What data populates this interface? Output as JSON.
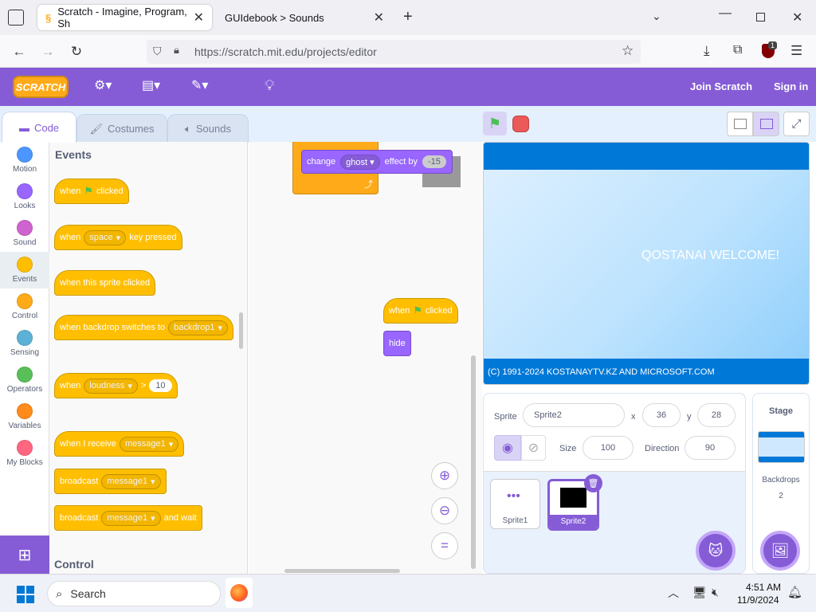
{
  "browser": {
    "tabs": [
      {
        "label": "Scratch - Imagine, Program, Sh"
      },
      {
        "label": "GUIdebook > Sounds"
      }
    ],
    "url": "https://scratch.mit.edu/projects/editor",
    "ext_badge": "1"
  },
  "menu": {
    "logo": "SCRATCH",
    "join": "Join Scratch",
    "signin": "Sign in"
  },
  "editor_tabs": [
    "Code",
    "Costumes",
    "Sounds"
  ],
  "categories": [
    {
      "label": "Motion",
      "color": "#4c97ff"
    },
    {
      "label": "Looks",
      "color": "#9966ff"
    },
    {
      "label": "Sound",
      "color": "#cf63cf"
    },
    {
      "label": "Events",
      "color": "#ffbf00"
    },
    {
      "label": "Control",
      "color": "#ffab19"
    },
    {
      "label": "Sensing",
      "color": "#5cb1d6"
    },
    {
      "label": "Operators",
      "color": "#59c059"
    },
    {
      "label": "Variables",
      "color": "#ff8c1a"
    },
    {
      "label": "My Blocks",
      "color": "#ff6680"
    }
  ],
  "palette": {
    "title": "Events",
    "control_title": "Control",
    "blocks": {
      "flag_when": "when",
      "flag_clicked": "clicked",
      "key_when": "when",
      "key_value": "space",
      "key_pressed": "key pressed",
      "sprite_clicked": "when this sprite clicked",
      "backdrop_text": "when backdrop switches to",
      "backdrop_value": "backdrop1",
      "loud_when": "when",
      "loud_value": "loudness",
      "loud_op": ">",
      "loud_num": "10",
      "receive_text": "when I receive",
      "receive_value": "message1",
      "broadcast_text": "broadcast",
      "broadcast_value": "message1",
      "bwait_text": "broadcast",
      "bwait_value": "message1",
      "bwait_end": "and wait"
    }
  },
  "scripts": {
    "change_text": "change",
    "change_value": "ghost",
    "effect_text": "effect by",
    "effect_num": "-15",
    "hat_when": "when",
    "hat_clicked": "clicked",
    "hide_text": "hide"
  },
  "stage": {
    "welcome": "QOSTANAI WELCOME!",
    "footer": "(C) 1991-2024 KOSTANAYTV.KZ AND MICROSOFT.COM"
  },
  "sprite_info": {
    "sprite_label": "Sprite",
    "sprite_name": "Sprite2",
    "x_label": "x",
    "x": "36",
    "y_label": "y",
    "y": "28",
    "size_label": "Size",
    "size": "100",
    "dir_label": "Direction",
    "direction": "90"
  },
  "sprites": [
    {
      "name": "Sprite1"
    },
    {
      "name": "Sprite2"
    }
  ],
  "stage_panel": {
    "title": "Stage",
    "backdrops_label": "Backdrops",
    "backdrops_count": "2"
  },
  "taskbar": {
    "search": "Search",
    "time": "4:51 AM",
    "date": "11/9/2024"
  }
}
